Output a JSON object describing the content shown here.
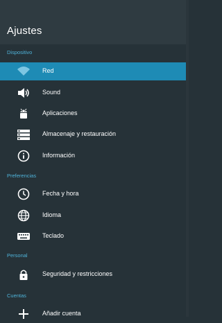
{
  "header": {
    "title": "Ajustes"
  },
  "colors": {
    "background": "#263238",
    "header": "#2f3b41",
    "accent": "#4fb3d9",
    "selected": "#1e8bb5"
  },
  "sections": {
    "dispositivo": {
      "label": "Dispositivo",
      "items": [
        {
          "label": "Red",
          "icon": "wifi-icon",
          "selected": true
        },
        {
          "label": "Sound",
          "icon": "speaker-icon"
        },
        {
          "label": "Aplicaciones",
          "icon": "android-icon"
        },
        {
          "label": "Almacenaje y restauración",
          "icon": "storage-icon"
        },
        {
          "label": "Información",
          "icon": "info-icon"
        }
      ]
    },
    "preferencias": {
      "label": "Preferencias",
      "items": [
        {
          "label": "Fecha y hora",
          "icon": "clock-icon"
        },
        {
          "label": "Idioma",
          "icon": "globe-icon"
        },
        {
          "label": "Teclado",
          "icon": "keyboard-icon"
        }
      ]
    },
    "personal": {
      "label": "Personal",
      "items": [
        {
          "label": "Seguridad y restricciones",
          "icon": "lock-icon"
        }
      ]
    },
    "cuentas": {
      "label": "Cuentas",
      "items": [
        {
          "label": "Añadir cuenta",
          "icon": "plus-icon"
        }
      ]
    }
  }
}
